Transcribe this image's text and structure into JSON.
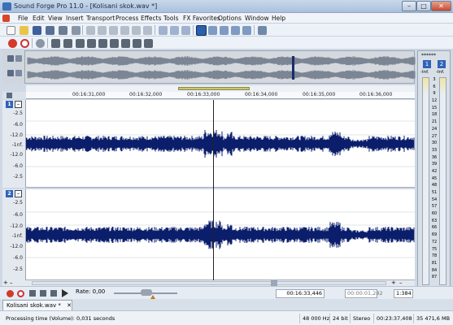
{
  "window": {
    "title": "Sound Forge Pro 11.0 - [Kolisani skok.wav *]"
  },
  "menu": [
    "File",
    "Edit",
    "View",
    "Insert",
    "Transport",
    "Process",
    "Effects",
    "Tools",
    "FX Favorites",
    "Options",
    "Window",
    "Help"
  ],
  "ruler": {
    "ticks": [
      "00:16:31,000",
      "00:16:32,000",
      "00:16:33,000",
      "00:16:34,000",
      "00:16:35,000",
      "00:16:36,000"
    ]
  },
  "channels": [
    {
      "number": "1",
      "db_labels": [
        "-2.5",
        "-6.0",
        "-12.0",
        "-1nf.",
        "-12.0",
        "-6.0",
        "-2.5"
      ]
    },
    {
      "number": "2",
      "db_labels": [
        "-2.5",
        "-6.0",
        "-12.0",
        "-1nf.",
        "-12.0",
        "-6.0",
        "-2.5"
      ]
    }
  ],
  "meter": {
    "header": "******",
    "ch1": "1",
    "ch2": "2",
    "peak_left": "-Inf.",
    "peak_right": "-Inf.",
    "scale": [
      "3",
      "6",
      "9",
      "12",
      "15",
      "18",
      "21",
      "24",
      "27",
      "30",
      "33",
      "36",
      "39",
      "42",
      "45",
      "48",
      "51",
      "54",
      "57",
      "60",
      "63",
      "66",
      "69",
      "72",
      "75",
      "78",
      "81",
      "84",
      "87"
    ]
  },
  "transport": {
    "rate_label": "Rate: 0,00",
    "cursor_position": "00:16:33,446",
    "selection_length": "00:00:01,282",
    "zoom": "1:384"
  },
  "doc_tab": {
    "label": "Kolisani skok.wav *"
  },
  "status": {
    "message": "Processing time (Volume): 0,031 seconds",
    "sample_rate": "48 000 Hz",
    "bit_depth": "24 bit",
    "channels": "Stereo",
    "length": "00:23:37,408",
    "free_space": "35 471,6 MB"
  },
  "colors": {
    "waveform": "#0b1e6b",
    "accent": "#2e63b8"
  }
}
